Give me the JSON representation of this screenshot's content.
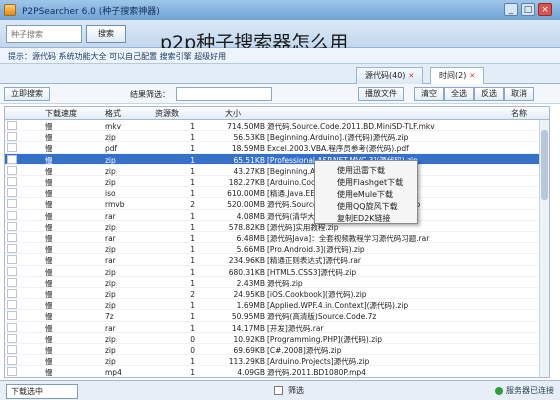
{
  "window": {
    "title": "P2PSearcher 6.0 (种子搜索神器)",
    "minimize": "_",
    "maximize": "□",
    "close": "×"
  },
  "headline": "p2p种子搜索器怎么用",
  "search": {
    "placeholder": "种子搜索",
    "button": "搜索"
  },
  "info": {
    "text": "提示：源代码 系统功能大全 可以自己配置 搜索引擎 超级好用"
  },
  "tabs": [
    {
      "label": "源代码(40)",
      "active": false
    },
    {
      "label": "时间(2)",
      "active": true
    }
  ],
  "toolbar": {
    "buttons": [
      "立即搜索",
      "播放文件",
      "清空",
      "全选",
      "反选",
      "取消"
    ],
    "filter_label": "结果筛选："
  },
  "table": {
    "headers": {
      "name": "名称",
      "size": "大小",
      "resources": "资源数",
      "format": "格式",
      "download": "下载速度"
    },
    "rows": [
      {
        "name": "源代码.Source.Code.2011.BD.MiniSD-TLF.mkv",
        "size": "714.50MB",
        "res": "1",
        "fmt": "mkv",
        "dl": "慢"
      },
      {
        "name": "[Beginning.Arduino].(源代码)源代码.zip",
        "size": "56.53KB",
        "res": "1",
        "fmt": "zip",
        "dl": "慢"
      },
      {
        "name": "Excel.2003.VBA.程序员参考(源代码).pdf",
        "size": "18.59MB",
        "res": "1",
        "fmt": "pdf",
        "dl": "慢"
      },
      {
        "name": "[Professional.ASP.NET.MVC.3](源代码).zip",
        "size": "65.51KB",
        "res": "1",
        "fmt": "zip",
        "dl": "慢",
        "selected": true
      },
      {
        "name": "[Beginning.Arduino](源代码)源代码.zip",
        "size": "43.27KB",
        "res": "1",
        "fmt": "zip",
        "dl": "慢"
      },
      {
        "name": "[Arduino.Cookbook](源代码)源代码.zip",
        "size": "182.27KB",
        "res": "1",
        "fmt": "zip",
        "dl": "慢"
      },
      {
        "name": "[精通.Java.EE.开发](源代码).iso",
        "size": "610.00MB",
        "res": "1",
        "fmt": "iso",
        "dl": "慢"
      },
      {
        "name": "源代码.Source.Code.2011.BD.RMVB.rmvb",
        "size": "520.00MB",
        "res": "2",
        "fmt": "rmvb",
        "dl": "慢"
      },
      {
        "name": "源代码(清华大学出版社)人工智能技术.rar",
        "size": "4.08MB",
        "res": "1",
        "fmt": "rar",
        "dl": "慢"
      },
      {
        "name": "[源代码]实用教程.zip",
        "size": "578.82KB",
        "res": "1",
        "fmt": "zip",
        "dl": "慢"
      },
      {
        "name": "[源代码Java]：全套视频教程学习源代码习题.rar",
        "size": "6.48MB",
        "res": "1",
        "fmt": "rar",
        "dl": "慢"
      },
      {
        "name": "[Pro.Android.3](源代码).zip",
        "size": "5.66MB",
        "res": "1",
        "fmt": "zip",
        "dl": "慢"
      },
      {
        "name": "[精通正则表达式]源代码.rar",
        "size": "234.96KB",
        "res": "1",
        "fmt": "rar",
        "dl": "慢"
      },
      {
        "name": "[HTML5.CSS3]源代码.zip",
        "size": "680.31KB",
        "res": "1",
        "fmt": "zip",
        "dl": "慢"
      },
      {
        "name": "源代码.zip",
        "size": "2.43MB",
        "res": "1",
        "fmt": "zip",
        "dl": "慢"
      },
      {
        "name": "[iOS.Cookbook](源代码).zip",
        "size": "24.95KB",
        "res": "2",
        "fmt": "zip",
        "dl": "慢"
      },
      {
        "name": "[Applied.WPF.4.in.Context](源代码).zip",
        "size": "1.69MB",
        "res": "1",
        "fmt": "zip",
        "dl": "慢"
      },
      {
        "name": "源代码(高清版)Source.Code.7z",
        "size": "50.95MB",
        "res": "1",
        "fmt": "7z",
        "dl": "慢"
      },
      {
        "name": "[开发]源代码.rar",
        "size": "14.17MB",
        "res": "1",
        "fmt": "rar",
        "dl": "慢"
      },
      {
        "name": "[Programming.PHP](源代码).zip",
        "size": "10.92KB",
        "res": "0",
        "fmt": "zip",
        "dl": "慢"
      },
      {
        "name": "[C#.2008]源代码.zip",
        "size": "69.69KB",
        "res": "0",
        "fmt": "zip",
        "dl": "慢"
      },
      {
        "name": "[Arduino.Projects]源代码.zip",
        "size": "113.29KB",
        "res": "1",
        "fmt": "zip",
        "dl": "慢"
      },
      {
        "name": "源代码.2011.BD1080P.mp4",
        "size": "4.09GB",
        "res": "1",
        "fmt": "mp4",
        "dl": "慢"
      }
    ]
  },
  "context_menu": {
    "items": [
      "使用迅雷下载",
      "使用Flashget下载",
      "使用eMule下载",
      "使用QQ旋风下载",
      "复制ED2K链接"
    ]
  },
  "footer": {
    "download_select": "下载选中",
    "checkbox_label": "筛选",
    "status": "服务器已连接"
  }
}
